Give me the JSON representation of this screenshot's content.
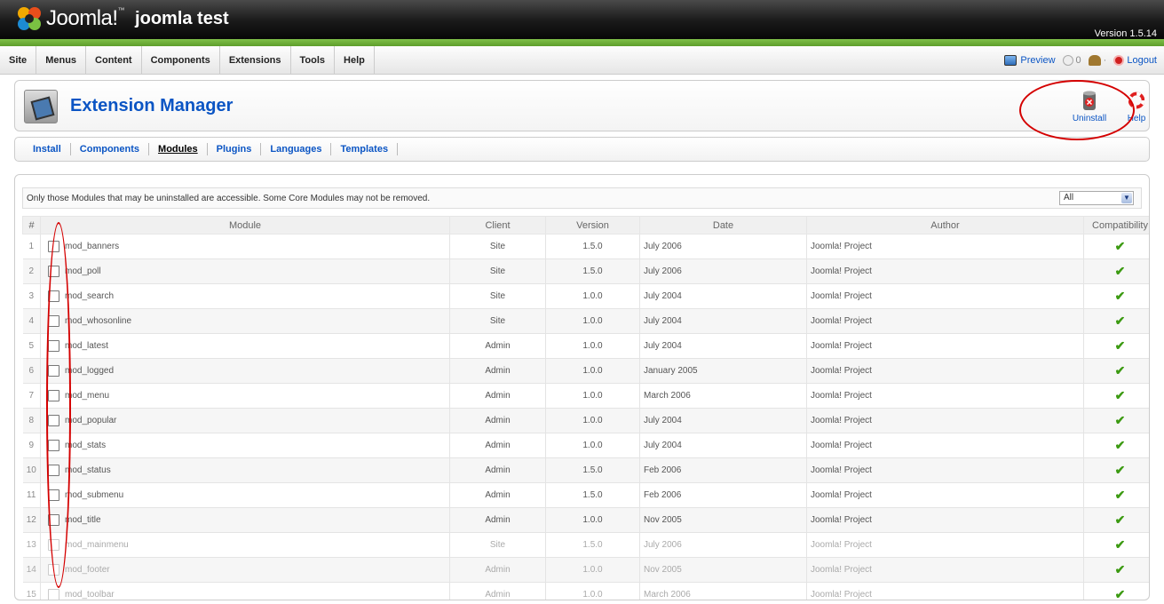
{
  "header": {
    "logo_text": "Joomla!",
    "logo_sup": "™",
    "site_name": "joomla test",
    "version": "Version 1.5.14"
  },
  "menubar": {
    "items": [
      "Site",
      "Menus",
      "Content",
      "Components",
      "Extensions",
      "Tools",
      "Help"
    ],
    "preview_label": "Preview",
    "messages_count": "0",
    "users_count": "·",
    "logout_label": "Logout"
  },
  "toolbar": {
    "title": "Extension Manager",
    "uninstall_label": "Uninstall",
    "help_label": "Help"
  },
  "submenu": {
    "items": [
      "Install",
      "Components",
      "Modules",
      "Plugins",
      "Languages",
      "Templates"
    ],
    "active": "Modules"
  },
  "filter": {
    "note": "Only those Modules that may be uninstalled are accessible. Some Core Modules may not be removed.",
    "select_value": "All"
  },
  "table": {
    "headers": [
      "#",
      "Module",
      "Client",
      "Version",
      "Date",
      "Author",
      "Compatibility"
    ],
    "rows": [
      {
        "num": "1",
        "name": "mod_banners",
        "client": "Site",
        "version": "1.5.0",
        "date": "July 2006",
        "author": "Joomla! Project",
        "disabled": false
      },
      {
        "num": "2",
        "name": "mod_poll",
        "client": "Site",
        "version": "1.5.0",
        "date": "July 2006",
        "author": "Joomla! Project",
        "disabled": false
      },
      {
        "num": "3",
        "name": "mod_search",
        "client": "Site",
        "version": "1.0.0",
        "date": "July 2004",
        "author": "Joomla! Project",
        "disabled": false
      },
      {
        "num": "4",
        "name": "mod_whosonline",
        "client": "Site",
        "version": "1.0.0",
        "date": "July 2004",
        "author": "Joomla! Project",
        "disabled": false
      },
      {
        "num": "5",
        "name": "mod_latest",
        "client": "Admin",
        "version": "1.0.0",
        "date": "July 2004",
        "author": "Joomla! Project",
        "disabled": false
      },
      {
        "num": "6",
        "name": "mod_logged",
        "client": "Admin",
        "version": "1.0.0",
        "date": "January 2005",
        "author": "Joomla! Project",
        "disabled": false
      },
      {
        "num": "7",
        "name": "mod_menu",
        "client": "Admin",
        "version": "1.0.0",
        "date": "March 2006",
        "author": "Joomla! Project",
        "disabled": false
      },
      {
        "num": "8",
        "name": "mod_popular",
        "client": "Admin",
        "version": "1.0.0",
        "date": "July 2004",
        "author": "Joomla! Project",
        "disabled": false
      },
      {
        "num": "9",
        "name": "mod_stats",
        "client": "Admin",
        "version": "1.0.0",
        "date": "July 2004",
        "author": "Joomla! Project",
        "disabled": false
      },
      {
        "num": "10",
        "name": "mod_status",
        "client": "Admin",
        "version": "1.5.0",
        "date": "Feb 2006",
        "author": "Joomla! Project",
        "disabled": false
      },
      {
        "num": "11",
        "name": "mod_submenu",
        "client": "Admin",
        "version": "1.5.0",
        "date": "Feb 2006",
        "author": "Joomla! Project",
        "disabled": false
      },
      {
        "num": "12",
        "name": "mod_title",
        "client": "Admin",
        "version": "1.0.0",
        "date": "Nov 2005",
        "author": "Joomla! Project",
        "disabled": false
      },
      {
        "num": "13",
        "name": "mod_mainmenu",
        "client": "Site",
        "version": "1.5.0",
        "date": "July 2006",
        "author": "Joomla! Project",
        "disabled": true
      },
      {
        "num": "14",
        "name": "mod_footer",
        "client": "Admin",
        "version": "1.0.0",
        "date": "Nov 2005",
        "author": "Joomla! Project",
        "disabled": true
      },
      {
        "num": "15",
        "name": "mod_toolbar",
        "client": "Admin",
        "version": "1.0.0",
        "date": "March 2006",
        "author": "Joomla! Project",
        "disabled": true
      }
    ],
    "compat_symbol": "✔"
  },
  "colors": {
    "link": "#0b55c4",
    "header_green": "#6fb03a",
    "annotation_red": "#d40000",
    "check_green": "#3c9a12"
  }
}
